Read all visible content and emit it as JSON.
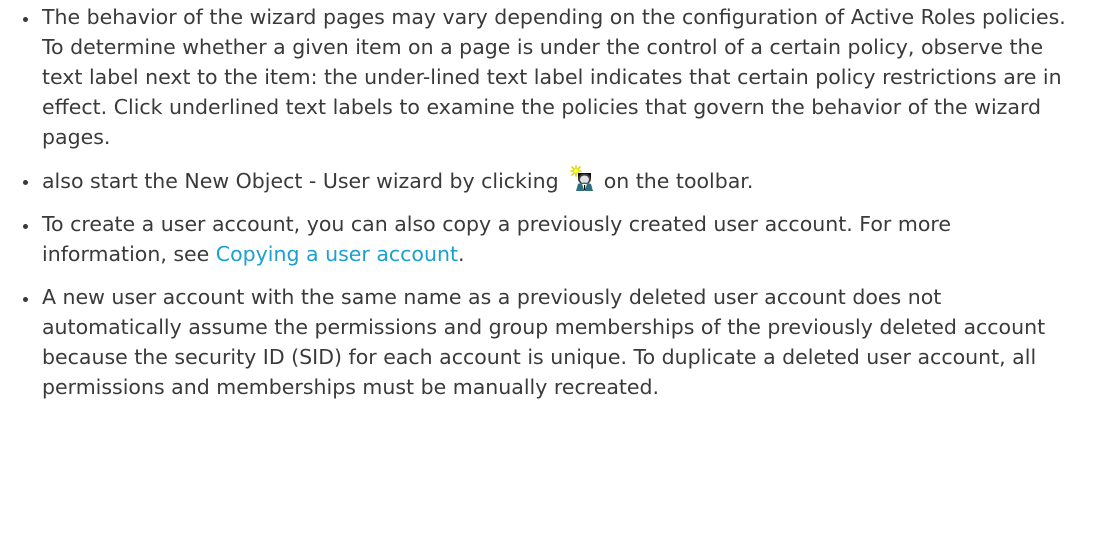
{
  "notes": [
    {
      "text": "The behavior of the wizard pages may vary depending on the configuration of Active Roles policies. To determine whether a given item on a page is under the control of a certain policy, observe the text label next to the item: the under-lined text label indicates that certain policy restrictions are in effect. Click underlined text labels to examine the policies that govern the behavior of the wizard pages."
    },
    {
      "text_before_icon": "also start the New Object - User wizard by clicking",
      "icon": "new-user-wizard-icon",
      "text_after_icon": "on the toolbar."
    },
    {
      "text": "To create a user account, you can also copy a previously created user account. For more information, see",
      "link_label": "Copying a user account",
      "text_after_link": "."
    },
    {
      "text": "A new user account with the same name as a previously deleted user account does not automatically assume the permissions and group memberships of the previously deleted account because the security ID (SID) for each account is unique. To duplicate a deleted user account, all permissions and memberships must be manually recreated."
    }
  ],
  "colors": {
    "text": "#3a3a3a",
    "link": "#1ba0cf"
  }
}
